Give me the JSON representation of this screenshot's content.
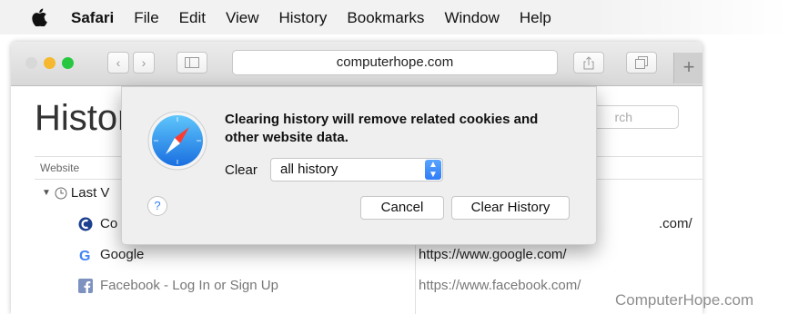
{
  "menubar": {
    "app_name": "Safari",
    "items": [
      "File",
      "Edit",
      "View",
      "History",
      "Bookmarks",
      "Window",
      "Help"
    ]
  },
  "toolbar": {
    "address": "computerhope.com",
    "new_tab_label": "+"
  },
  "page": {
    "title": "Histor",
    "search_placeholder": "rch",
    "column_website": "Website",
    "group_label": "Last V",
    "rows": [
      {
        "site": "Co",
        "url": ".com/"
      },
      {
        "site": "Google",
        "url": "https://www.google.com/"
      },
      {
        "site": "Facebook - Log In or Sign Up",
        "url": "https://www.facebook.com/"
      }
    ]
  },
  "dialog": {
    "message": "Clearing history will remove related cookies and other website data.",
    "clear_label": "Clear",
    "select_value": "all history",
    "help_label": "?",
    "cancel_label": "Cancel",
    "confirm_label": "Clear History"
  },
  "watermark": "ComputerHope.com",
  "colors": {
    "accent": "#2f7cf6",
    "close": "#d8d8d8",
    "minimize": "#f5b82e",
    "zoom": "#27c840"
  }
}
